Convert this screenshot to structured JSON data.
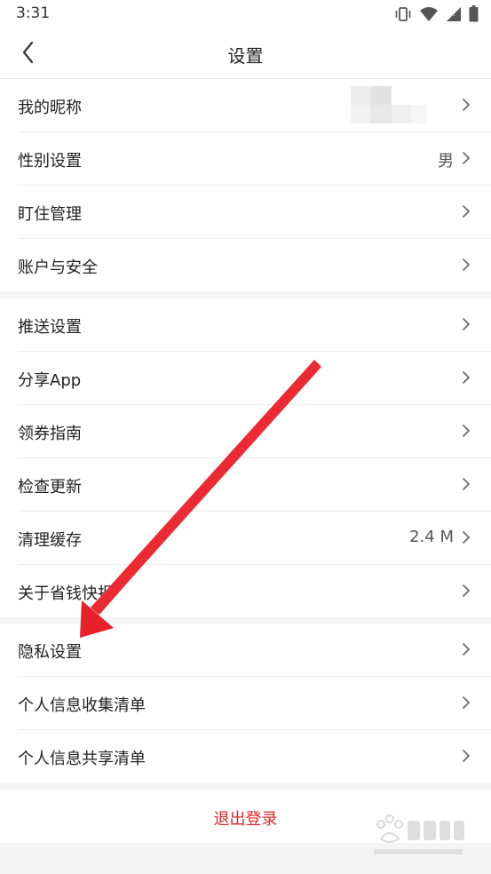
{
  "status_bar": {
    "time": "3:31"
  },
  "nav": {
    "title": "设置"
  },
  "group1": [
    {
      "label": "我的昵称",
      "value": ""
    },
    {
      "label": "性别设置",
      "value": "男"
    },
    {
      "label": "盯住管理",
      "value": ""
    },
    {
      "label": "账户与安全",
      "value": ""
    }
  ],
  "group2": [
    {
      "label": "推送设置",
      "value": ""
    },
    {
      "label": "分享App",
      "value": ""
    },
    {
      "label": "领券指南",
      "value": ""
    },
    {
      "label": "检查更新",
      "value": ""
    },
    {
      "label": "清理缓存",
      "value": "2.4 M"
    },
    {
      "label": "关于省钱快报",
      "value": ""
    }
  ],
  "group3": [
    {
      "label": "隐私设置",
      "value": ""
    },
    {
      "label": "个人信息收集清单",
      "value": ""
    },
    {
      "label": "个人信息共享清单",
      "value": ""
    }
  ],
  "logout": {
    "label": "退出登录"
  },
  "colors": {
    "accent": "#e0242a",
    "annotation_arrow": "#e8202a"
  },
  "icons": {
    "back": "chevron-left-icon",
    "row_action": "chevron-right-icon",
    "vibrate": "vibrate-icon",
    "wifi": "wifi-icon",
    "signal": "signal-icon",
    "battery": "battery-icon"
  }
}
